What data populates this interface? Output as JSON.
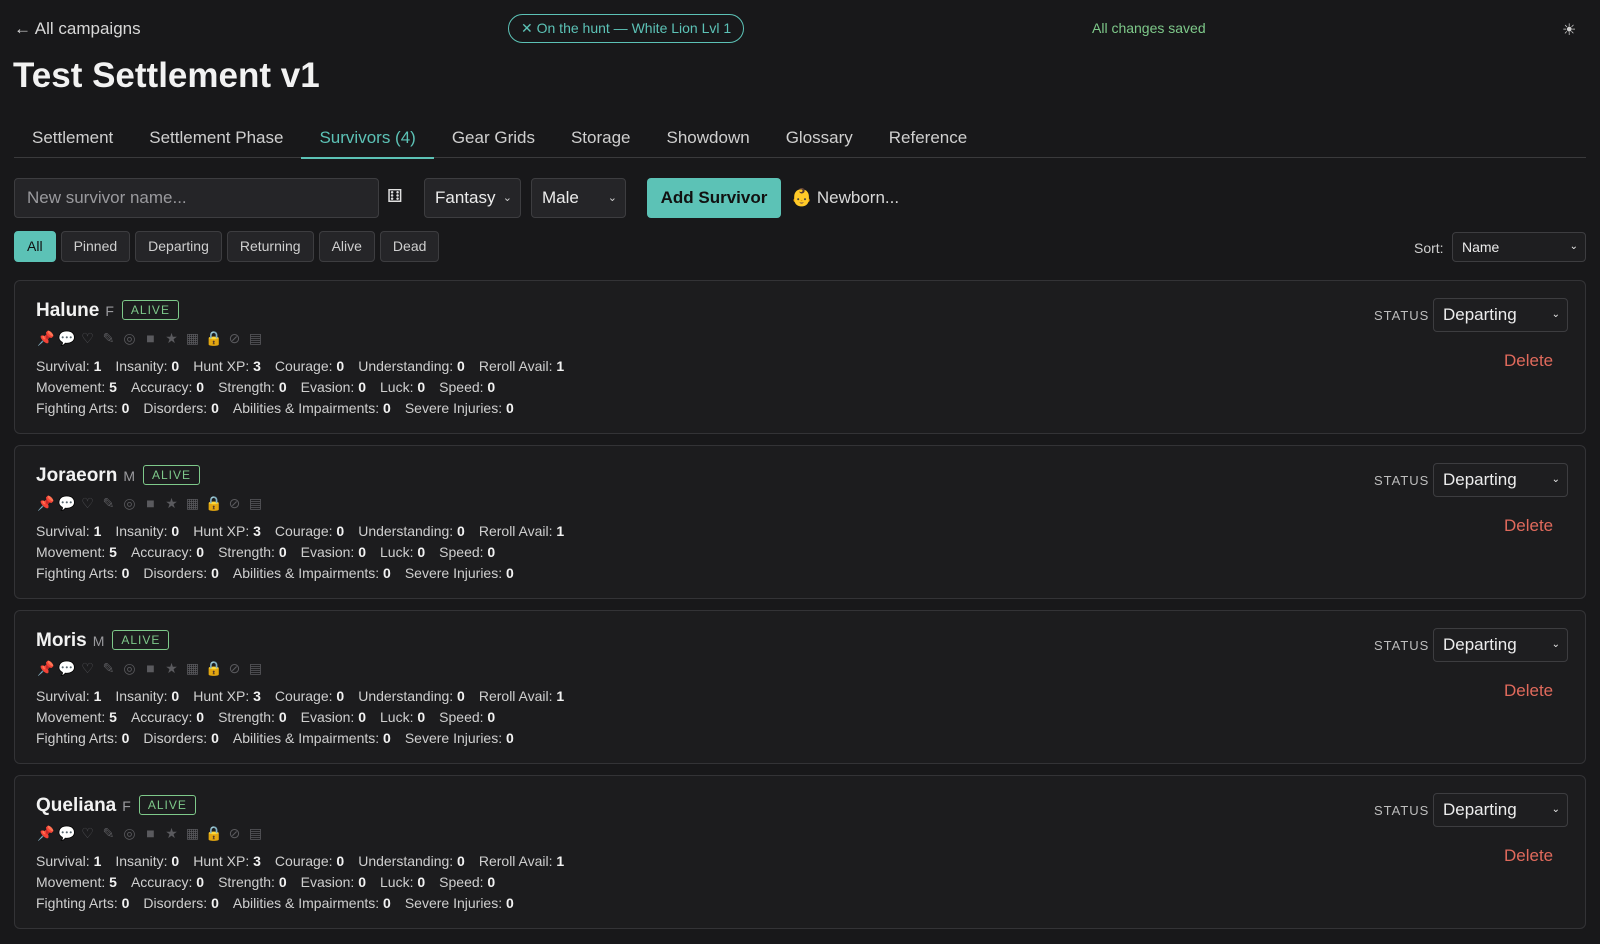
{
  "header": {
    "back_label": "← All campaigns",
    "hunt_pill": "✕ On the hunt — White Lion Lvl 1",
    "save_status": "All changes saved",
    "theme_icon": "☀"
  },
  "page_title": "Test Settlement v1",
  "tabs": [
    {
      "label": "Settlement"
    },
    {
      "label": "Settlement Phase"
    },
    {
      "label": "Survivors (4)"
    },
    {
      "label": "Gear Grids"
    },
    {
      "label": "Storage"
    },
    {
      "label": "Showdown"
    },
    {
      "label": "Glossary"
    },
    {
      "label": "Reference"
    }
  ],
  "active_tab": "Survivors (4)",
  "add_form": {
    "name_placeholder": "New survivor name...",
    "dice_icon": "⚅",
    "name_style": "Fantasy",
    "gender": "Male",
    "add_label": "Add Survivor",
    "newborn_label": "👶 Newborn..."
  },
  "filters": [
    "All",
    "Pinned",
    "Departing",
    "Returning",
    "Alive",
    "Dead"
  ],
  "active_filter": "All",
  "sort": {
    "label": "Sort:",
    "value": "Name"
  },
  "status_label": "STATUS",
  "delete_label": "Delete",
  "alive_badge": "ALIVE",
  "stat_labels": {
    "survival": "Survival:",
    "insanity": "Insanity:",
    "hunt_xp": "Hunt XP:",
    "courage": "Courage:",
    "understanding": "Understanding:",
    "reroll": "Reroll Avail:",
    "movement": "Movement:",
    "accuracy": "Accuracy:",
    "strength": "Strength:",
    "evasion": "Evasion:",
    "luck": "Luck:",
    "speed": "Speed:",
    "fighting_arts": "Fighting Arts:",
    "disorders": "Disorders:",
    "abilities": "Abilities & Impairments:",
    "severe_injuries": "Severe Injuries:"
  },
  "survivors": [
    {
      "name": "Halune",
      "gender": "F",
      "status": "Departing",
      "stats": {
        "survival": "1",
        "insanity": "0",
        "hunt_xp": "3",
        "courage": "0",
        "understanding": "0",
        "reroll": "1",
        "movement": "5",
        "accuracy": "0",
        "strength": "0",
        "evasion": "0",
        "luck": "0",
        "speed": "0",
        "fighting_arts": "0",
        "disorders": "0",
        "abilities": "0",
        "severe_injuries": "0"
      }
    },
    {
      "name": "Joraeorn",
      "gender": "M",
      "status": "Departing",
      "stats": {
        "survival": "1",
        "insanity": "0",
        "hunt_xp": "3",
        "courage": "0",
        "understanding": "0",
        "reroll": "1",
        "movement": "5",
        "accuracy": "0",
        "strength": "0",
        "evasion": "0",
        "luck": "0",
        "speed": "0",
        "fighting_arts": "0",
        "disorders": "0",
        "abilities": "0",
        "severe_injuries": "0"
      }
    },
    {
      "name": "Moris",
      "gender": "M",
      "status": "Departing",
      "stats": {
        "survival": "1",
        "insanity": "0",
        "hunt_xp": "3",
        "courage": "0",
        "understanding": "0",
        "reroll": "1",
        "movement": "5",
        "accuracy": "0",
        "strength": "0",
        "evasion": "0",
        "luck": "0",
        "speed": "0",
        "fighting_arts": "0",
        "disorders": "0",
        "abilities": "0",
        "severe_injuries": "0"
      }
    },
    {
      "name": "Queliana",
      "gender": "F",
      "status": "Departing",
      "stats": {
        "survival": "1",
        "insanity": "0",
        "hunt_xp": "3",
        "courage": "0",
        "understanding": "0",
        "reroll": "1",
        "movement": "5",
        "accuracy": "0",
        "strength": "0",
        "evasion": "0",
        "luck": "0",
        "speed": "0",
        "fighting_arts": "0",
        "disorders": "0",
        "abilities": "0",
        "severe_injuries": "0"
      }
    }
  ],
  "survivor_icons": [
    "pin-icon",
    "brain-icon",
    "heart-icon",
    "feather-icon",
    "spiral-icon",
    "square-icon",
    "star-icon",
    "film-icon",
    "lock-icon",
    "ban-icon",
    "notes-icon"
  ],
  "colors": {
    "accent": "#5cc2b6",
    "alive": "#7ec98a",
    "danger": "#e06a5c",
    "bg": "#18181a"
  }
}
